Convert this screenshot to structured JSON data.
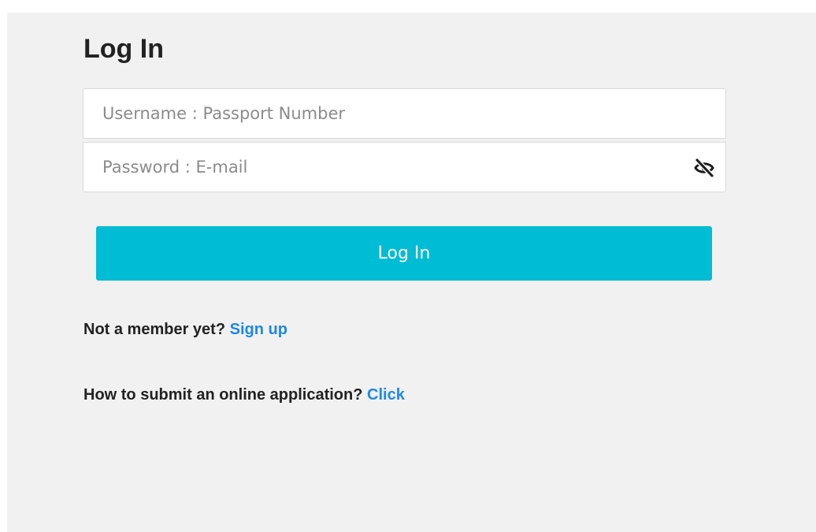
{
  "form": {
    "title": "Log In",
    "username_placeholder": "Username : Passport Number",
    "username_value": "",
    "password_placeholder": "Password : E-mail",
    "password_value": "",
    "password_toggle_icon": "eye-slash-icon",
    "submit_label": "Log In"
  },
  "signup": {
    "prompt": "Not a member yet?",
    "link_label": "Sign up"
  },
  "help": {
    "prompt": "How to submit an online application?",
    "link_label": "Click"
  },
  "colors": {
    "panel_background": "#f1f1f1",
    "button_background": "#00bcd4",
    "link": "#1e88e5",
    "text": "#222222"
  }
}
